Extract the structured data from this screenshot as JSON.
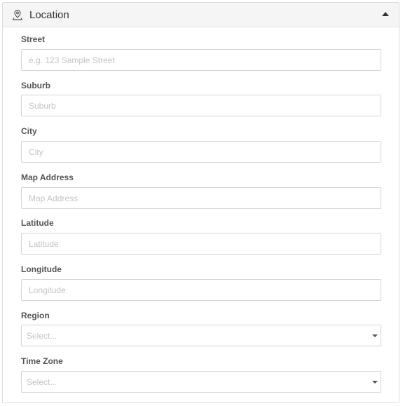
{
  "panel": {
    "title": "Location",
    "header_icon": "map-pin-person-icon",
    "collapse_icon": "caret-up-icon"
  },
  "fields": {
    "street": {
      "label": "Street",
      "placeholder": "e.g. 123 Sample Street"
    },
    "suburb": {
      "label": "Suburb",
      "placeholder": "Suburb"
    },
    "city": {
      "label": "City",
      "placeholder": "City"
    },
    "map_address": {
      "label": "Map Address",
      "placeholder": "Map Address"
    },
    "latitude": {
      "label": "Latitude",
      "placeholder": "Latitude"
    },
    "longitude": {
      "label": "Longitude",
      "placeholder": "Longitude"
    },
    "region": {
      "label": "Region",
      "selected": "Select..."
    },
    "time_zone": {
      "label": "Time Zone",
      "selected": "Select..."
    }
  }
}
